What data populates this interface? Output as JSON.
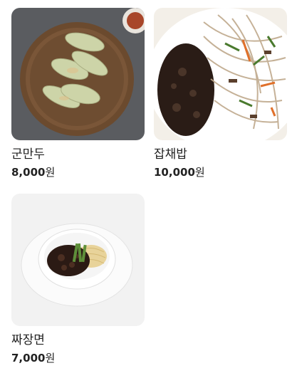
{
  "menu": {
    "items": [
      {
        "name": "군만두",
        "price": "8,000",
        "currency": "원",
        "image": "fried-dumplings-photo"
      },
      {
        "name": "잡채밥",
        "price": "10,000",
        "currency": "원",
        "image": "japchae-rice-photo"
      },
      {
        "name": "짜장면",
        "price": "7,000",
        "currency": "원",
        "image": "jajangmyeon-photo"
      }
    ]
  }
}
